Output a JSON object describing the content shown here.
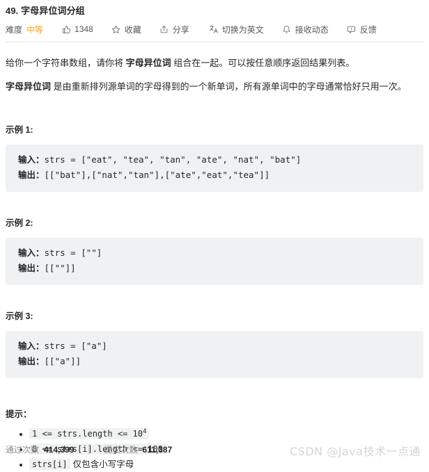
{
  "problem": {
    "title": "49. 字母异位词分组"
  },
  "meta": {
    "difficulty_label": "难度",
    "difficulty_value": "中等",
    "likes_count": "1348",
    "favorite_label": "收藏",
    "share_label": "分享",
    "translate_label": "切换为英文",
    "subscribe_label": "接收动态",
    "feedback_label": "反馈",
    "icons": {
      "thumbs_up": "thumbs-up-icon",
      "star": "star-icon",
      "share": "share-icon",
      "translate": "translate-icon",
      "bell": "bell-icon",
      "feedback": "feedback-icon"
    }
  },
  "description": {
    "p1_a": "给你一个字符串数组，请你将 ",
    "p1_b": "字母异位词",
    "p1_c": " 组合在一起。可以按任意顺序返回结果列表。",
    "p2_a": "字母异位词",
    "p2_b": " 是由重新排列源单词的字母得到的一个新单词，所有源单词中的字母通常恰好只用一次。"
  },
  "examples": [
    {
      "heading": "示例 1:",
      "input_label": "输入：",
      "input_value": "strs = [\"eat\", \"tea\", \"tan\", \"ate\", \"nat\", \"bat\"]",
      "output_label": "输出：",
      "output_value": "[[\"bat\"],[\"nat\",\"tan\"],[\"ate\",\"eat\",\"tea\"]]"
    },
    {
      "heading": "示例 2:",
      "input_label": "输入：",
      "input_value": "strs = [\"\"]",
      "output_label": "输出：",
      "output_value": "[[\"\"]]"
    },
    {
      "heading": "示例 3:",
      "input_label": "输入：",
      "input_value": "strs = [\"a\"]",
      "output_label": "输出：",
      "output_value": "[[\"a\"]]"
    }
  ],
  "hints": {
    "heading": "提示：",
    "items": [
      {
        "code_pre": "1 <= strs.length <= 10",
        "sup": "4",
        "code_post": "",
        "text": ""
      },
      {
        "code_pre": "0 <= strs[i].length <= 100",
        "sup": "",
        "code_post": "",
        "text": ""
      },
      {
        "code_pre": "strs[i]",
        "sup": "",
        "code_post": "",
        "text": "仅包含小写字母"
      }
    ]
  },
  "stats": {
    "passed_label": "通过次数",
    "passed_value": "414,399",
    "submitted_label": "提交次数",
    "submitted_value": "611,387"
  },
  "watermark": {
    "text": "CSDN @Java技术一点通"
  },
  "colors": {
    "difficulty_medium": "#ffa116",
    "code_bg": "#f0f1f2",
    "text": "#262626",
    "muted": "#8a8a8a",
    "divider": "#e5e5e5"
  }
}
